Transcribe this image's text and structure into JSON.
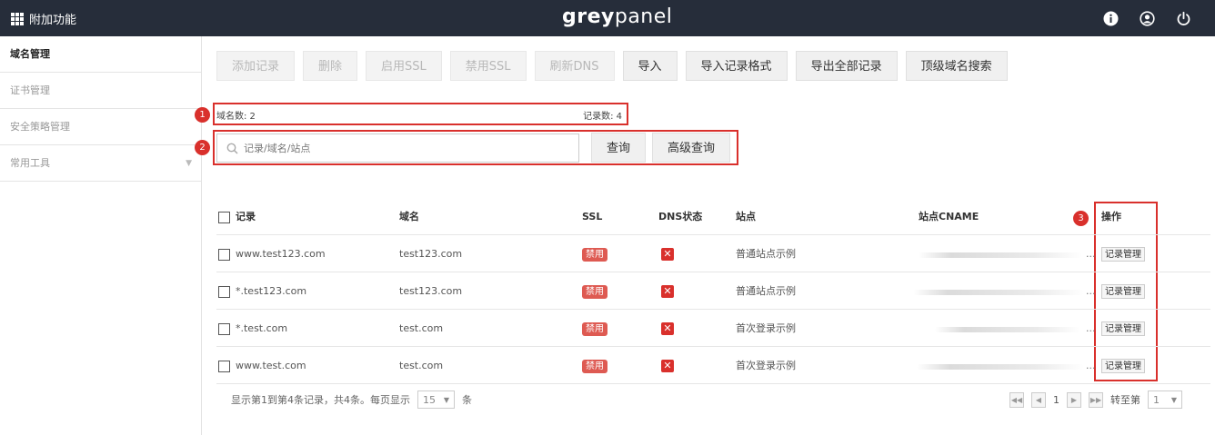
{
  "app": {
    "title": "附加功能",
    "brand_bold": "grey",
    "brand_light": "panel"
  },
  "top_icons": [
    "info-icon",
    "user-icon",
    "power-icon"
  ],
  "sidebar": {
    "items": [
      {
        "label": "域名管理",
        "active": true
      },
      {
        "label": "证书管理"
      },
      {
        "label": "安全策略管理"
      },
      {
        "label": "常用工具",
        "has_caret": true
      }
    ]
  },
  "toolbar": {
    "buttons": [
      {
        "label": "添加记录",
        "enabled": false
      },
      {
        "label": "删除",
        "enabled": false
      },
      {
        "label": "启用SSL",
        "enabled": false
      },
      {
        "label": "禁用SSL",
        "enabled": false
      },
      {
        "label": "刷新DNS",
        "enabled": false
      },
      {
        "label": "导入",
        "enabled": true
      },
      {
        "label": "导入记录格式",
        "enabled": true
      },
      {
        "label": "导出全部记录",
        "enabled": true
      },
      {
        "label": "顶级域名搜索",
        "enabled": true
      }
    ]
  },
  "annotations": [
    "1",
    "2",
    "3"
  ],
  "stats": {
    "domain_count": "域名数: 2",
    "record_count": "记录数: 4"
  },
  "search": {
    "placeholder": "记录/域名/站点",
    "query_label": "查询",
    "advanced_label": "高级查询"
  },
  "table": {
    "headers": [
      "记录",
      "域名",
      "SSL",
      "DNS状态",
      "站点",
      "站点CNAME",
      "操作"
    ],
    "rows": [
      {
        "record": "www.test123.com",
        "domain": "test123.com",
        "ssl": "禁用",
        "dns": "✕",
        "site": "普通站点示例",
        "cname": "...",
        "action": "记录管理"
      },
      {
        "record": "*.test123.com",
        "domain": "test123.com",
        "ssl": "禁用",
        "dns": "✕",
        "site": "普通站点示例",
        "cname": "...",
        "action": "记录管理"
      },
      {
        "record": "*.test.com",
        "domain": "test.com",
        "ssl": "禁用",
        "dns": "✕",
        "site": "首次登录示例",
        "cname": "...",
        "action": "记录管理"
      },
      {
        "record": "www.test.com",
        "domain": "test.com",
        "ssl": "禁用",
        "dns": "✕",
        "site": "首次登录示例",
        "cname": "...",
        "action": "记录管理"
      }
    ]
  },
  "footer": {
    "summary": "显示第1到第4条记录，共4条。每页显示",
    "page_size": "15",
    "unit": "条",
    "current_page": "1",
    "goto_label": "转至第",
    "goto_page": "1"
  },
  "colors": {
    "topbar": "#262d3a",
    "highlight": "#d9302c",
    "badge": "#de5a52"
  }
}
